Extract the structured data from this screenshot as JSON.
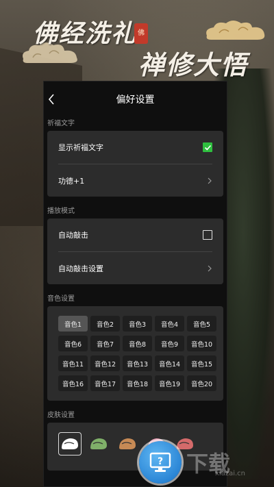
{
  "banner": {
    "title_line1": "佛经洗礼",
    "seal_text": "佛",
    "title_line2": "禅修大悟"
  },
  "nav": {
    "title": "偏好设置",
    "back_icon": "chevron-left-icon"
  },
  "sections": {
    "prayer_text": {
      "label": "祈福文字",
      "show_label": "显示祈福文字",
      "show_checked": true,
      "merit_label": "功德+1"
    },
    "play_mode": {
      "label": "播放模式",
      "auto_knock_label": "自动敲击",
      "auto_knock_checked": false,
      "auto_knock_settings_label": "自动敲击设置"
    },
    "tone": {
      "label": "音色设置",
      "selected_index": 0,
      "options": [
        "音色1",
        "音色2",
        "音色3",
        "音色4",
        "音色5",
        "音色6",
        "音色7",
        "音色8",
        "音色9",
        "音色10",
        "音色11",
        "音色12",
        "音色13",
        "音色14",
        "音色15",
        "音色16",
        "音色17",
        "音色18",
        "音色19",
        "音色20"
      ]
    },
    "skin": {
      "label": "皮肤设置",
      "skins": [
        {
          "name": "white-muyu-icon",
          "color": "#ffffff"
        },
        {
          "name": "green-muyu-icon",
          "color": "#7fb069"
        },
        {
          "name": "wood-muyu-icon",
          "color": "#c78a55"
        },
        {
          "name": "pink-muyu-icon",
          "color": "#e49bb0"
        },
        {
          "name": "red-muyu-icon",
          "color": "#d46a6a"
        }
      ]
    }
  },
  "watermark": {
    "text": "下载",
    "url": "xiazai.cn"
  },
  "colors": {
    "accent_check": "#2fbf3f",
    "card_bg": "#2c2c2c",
    "screen_bg": "#0f0f0f",
    "tone_selected": "#555555"
  }
}
